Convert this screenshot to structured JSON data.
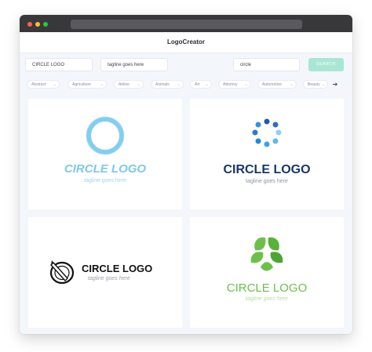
{
  "app": {
    "title": "LogoCreator"
  },
  "controls": {
    "name_value": "CIRCLE LOGO",
    "tagline_value": "tagline goes here",
    "keyword_value": "circle",
    "search_label": "SEARCH"
  },
  "categories": [
    "Abstract",
    "Agriculture",
    "Airline",
    "Animals",
    "Art",
    "Attorney",
    "Automotive",
    "Beauty"
  ],
  "logos": [
    {
      "name": "CIRCLE LOGO",
      "tagline": "tagline goes here",
      "color": "#7fc8ea"
    },
    {
      "name": "CIRCLE LOGO",
      "tagline": "tagline goes here",
      "color": "#1a3666"
    },
    {
      "name": "CIRCLE LOGO",
      "tagline": "tagline goes here",
      "color": "#111111"
    },
    {
      "name": "CIRCLE LOGO",
      "tagline": "tagline goes here",
      "color": "#6cc04a"
    }
  ]
}
